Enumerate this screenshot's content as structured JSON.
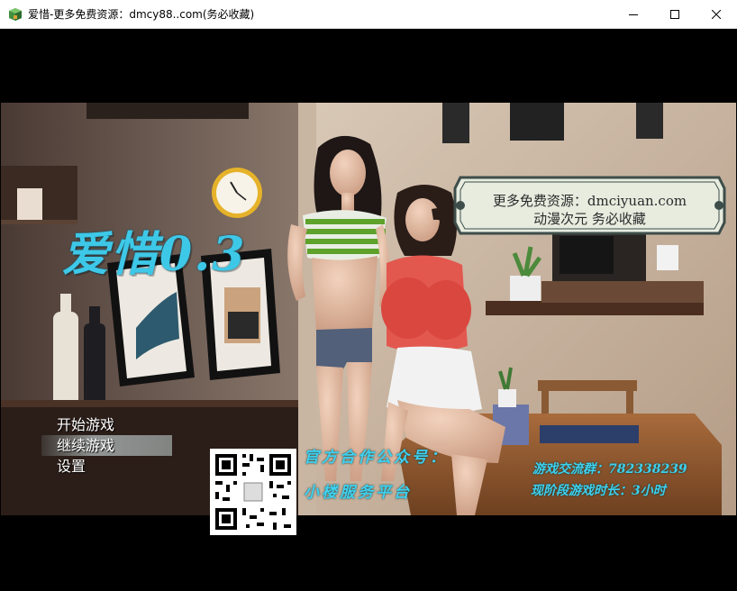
{
  "window": {
    "title": "爱惜-更多免费资源：dmcy88..com(务必收藏)",
    "minimize_glyph": "—",
    "maximize_glyph": "☐",
    "close_glyph": "✕"
  },
  "game": {
    "title": "爱惜0.3"
  },
  "banner": {
    "line1": "更多免费资源：dmciyuan.com",
    "line2": "动漫次元 务必收藏"
  },
  "menu": {
    "items": [
      {
        "label": "开始游戏"
      },
      {
        "label": "继续游戏"
      },
      {
        "label": "设置"
      }
    ],
    "selected_index": 1
  },
  "ads": {
    "official_label": "官方合作公众号：",
    "official_name": "小楼服务平台",
    "group_line": "游戏交流群：782338239",
    "playtime_line": "现阶段游戏时长：3小时"
  },
  "colors": {
    "accent_cyan": "#3ec8e8",
    "banner_fill": "#e7ecdf",
    "banner_border": "#3d4d4a"
  }
}
